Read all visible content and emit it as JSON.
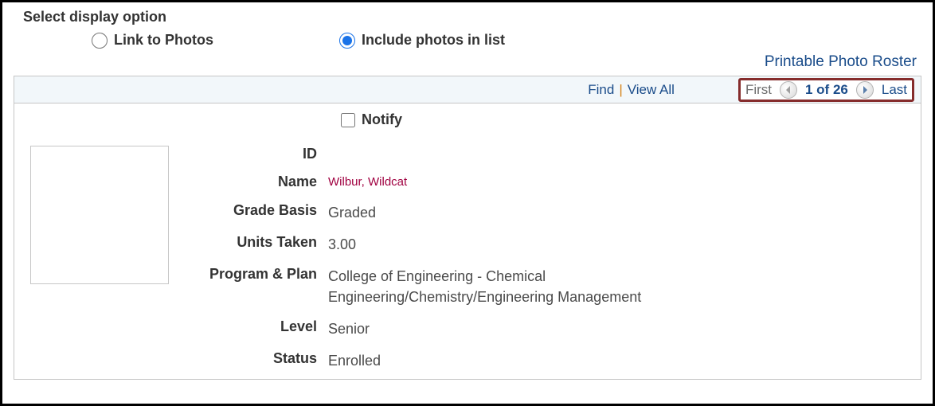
{
  "header": {
    "title": "Select display option",
    "option_link_photos": "Link to Photos",
    "option_include_photos": "Include photos in list",
    "printable_link": "Printable Photo Roster"
  },
  "gridbar": {
    "find": "Find",
    "view_all": "View All",
    "first": "First",
    "counter": "1 of 26",
    "last": "Last"
  },
  "content": {
    "notify_label": "Notify",
    "labels": {
      "id": "ID",
      "name": "Name",
      "grade_basis": "Grade Basis",
      "units_taken": "Units Taken",
      "program_plan": "Program & Plan",
      "level": "Level",
      "status": "Status"
    },
    "values": {
      "id": "",
      "name": "Wilbur, Wildcat",
      "grade_basis": "Graded",
      "units_taken": "3.00",
      "program_plan": "College of Engineering - Chemical Engineering/Chemistry/Engineering Management",
      "level": "Senior",
      "status": "Enrolled"
    }
  }
}
